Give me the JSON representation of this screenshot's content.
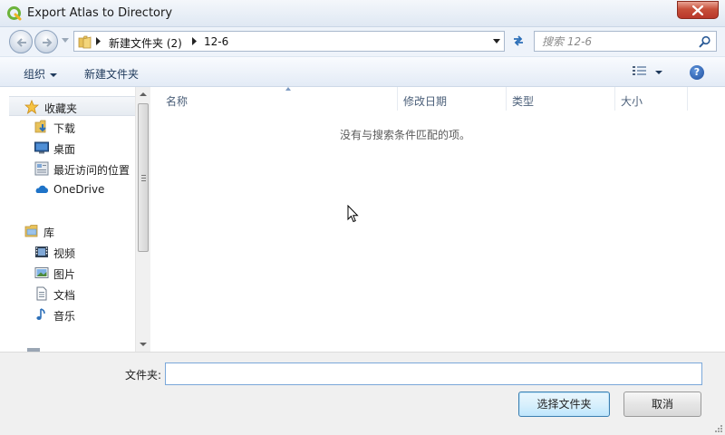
{
  "window": {
    "title": "Export Atlas to Directory"
  },
  "address": {
    "crumbs": [
      "新建文件夹 (2)",
      "12-6"
    ]
  },
  "search": {
    "placeholder": "搜索 12-6"
  },
  "toolbar": {
    "organize_label": "组织",
    "new_folder_label": "新建文件夹",
    "help_label": "?"
  },
  "nav": {
    "favorites_label": "收藏夹",
    "favorites": [
      {
        "label": "下载",
        "icon": "download-folder-icon"
      },
      {
        "label": "桌面",
        "icon": "desktop-icon"
      },
      {
        "label": "最近访问的位置",
        "icon": "recent-places-icon"
      },
      {
        "label": "OneDrive",
        "icon": "onedrive-icon"
      }
    ],
    "libraries_label": "库",
    "libraries": [
      {
        "label": "视频",
        "icon": "video-icon"
      },
      {
        "label": "图片",
        "icon": "pictures-icon"
      },
      {
        "label": "文档",
        "icon": "documents-icon"
      },
      {
        "label": "音乐",
        "icon": "music-icon"
      }
    ]
  },
  "columns": [
    "名称",
    "修改日期",
    "类型",
    "大小"
  ],
  "empty_message": "没有与搜索条件匹配的项。",
  "footer": {
    "folder_label": "文件夹:",
    "folder_value": "",
    "select_button": "选择文件夹",
    "cancel_button": "取消"
  },
  "colors": {
    "accent": "#3c7fb1",
    "close_button": "#c7503a"
  }
}
